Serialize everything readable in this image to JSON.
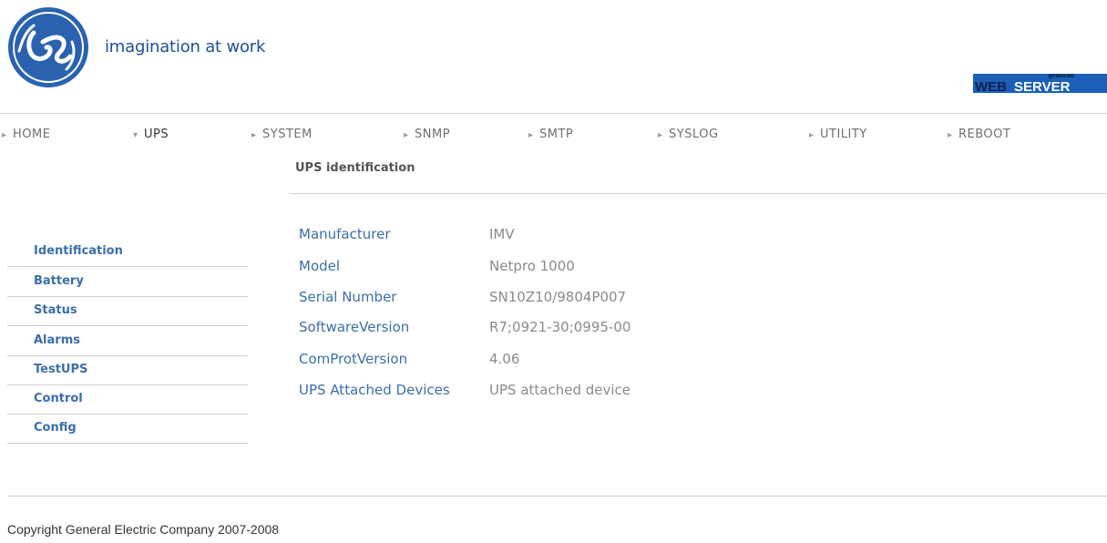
{
  "header": {
    "logo_text": "GE",
    "tagline": "imagination at work",
    "badge_small": "geahead",
    "badge_web": "WEB",
    "badge_server": "SERVER"
  },
  "nav": {
    "items": [
      {
        "label": "HOME",
        "arrow": "▸"
      },
      {
        "label": "UPS",
        "arrow": "▾"
      },
      {
        "label": "SYSTEM",
        "arrow": "▸"
      },
      {
        "label": "SNMP",
        "arrow": "▸"
      },
      {
        "label": "SMTP",
        "arrow": "▸"
      },
      {
        "label": "SYSLOG",
        "arrow": "▸"
      },
      {
        "label": "UTILITY",
        "arrow": "▸"
      },
      {
        "label": "REBOOT",
        "arrow": "▸"
      }
    ]
  },
  "page": {
    "title": "UPS identification"
  },
  "sidebar": {
    "items": [
      {
        "label": "Identification"
      },
      {
        "label": "Battery"
      },
      {
        "label": "Status"
      },
      {
        "label": "Alarms"
      },
      {
        "label": "TestUPS"
      },
      {
        "label": "Control"
      },
      {
        "label": "Config"
      }
    ]
  },
  "identification": {
    "rows": [
      {
        "label": "Manufacturer",
        "value": "IMV"
      },
      {
        "label": "Model",
        "value": "Netpro 1000"
      },
      {
        "label": "Serial Number",
        "value": "SN10Z10/9804P007"
      },
      {
        "label": "SoftwareVersion",
        "value": "R7;0921-30;0995-00"
      },
      {
        "label": "ComProtVersion",
        "value": "4.06"
      },
      {
        "label": "UPS Attached Devices",
        "value": "UPS attached device"
      }
    ]
  },
  "footer": {
    "copyright": "Copyright General Electric Company 2007-2008"
  },
  "colors": {
    "brand_blue": "#1a4f9c",
    "link_blue": "#3b6ea8",
    "badge_blue": "#1b5fb8",
    "divider": "#cfcfcf"
  }
}
